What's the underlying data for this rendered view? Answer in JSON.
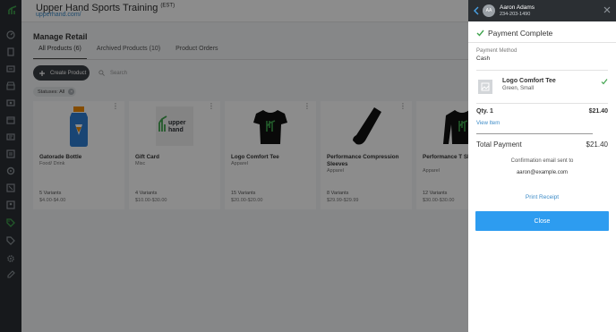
{
  "app": {
    "title": "Upper Hand Sports Training",
    "timezone": "(EST)",
    "url": "upperhand.com/"
  },
  "nav": {
    "icons": [
      "dashboard-icon",
      "book-icon",
      "reports-icon",
      "store-icon",
      "money-icon",
      "calendar-icon",
      "clients-icon",
      "messages-icon",
      "list-icon",
      "loop-icon",
      "schedule-icon",
      "contacts-icon",
      "retail-icon",
      "tag-icon",
      "settings-icon",
      "edit-icon"
    ]
  },
  "main": {
    "page_title": "Manage Retail",
    "tabs": [
      {
        "label": "All Products (6)"
      },
      {
        "label": "Archived Products (10)"
      },
      {
        "label": "Product Orders"
      }
    ],
    "create_label": "Create Product",
    "search_placeholder": "Search",
    "status_filter": "Statuses: All",
    "products": [
      {
        "name": "Gatorade Bottle",
        "category": "Food/ Drink",
        "variants": "5 Variants",
        "price": "$4.00-$4.00"
      },
      {
        "name": "Gift Card",
        "category": "Misc",
        "variants": "4 Variants",
        "price": "$10.00-$30.00",
        "logo_text": "upper hand"
      },
      {
        "name": "Logo Comfort Tee",
        "category": "Apparel",
        "variants": "15 Variants",
        "price": "$20.00-$20.00"
      },
      {
        "name": "Performance Compression Sleeves",
        "category": "Apparel",
        "variants": "8 Variants",
        "price": "$29.99-$29.99"
      },
      {
        "name": "Performance T Sl Sleeve",
        "category": "Apparel",
        "variants": "12 Variants",
        "price": "$30.00-$30.00"
      }
    ]
  },
  "drawer": {
    "client": {
      "initials": "AA",
      "name": "Aaron Adams",
      "phone": "234-203-1490"
    },
    "status_title": "Payment Complete",
    "payment_method_label": "Payment Method",
    "payment_method": "Cash",
    "item": {
      "name": "Logo Comfort Tee",
      "description": "Green, Small"
    },
    "qty_label": "Qty. 1",
    "line_total": "$21.40",
    "view_item": "View Item",
    "total_label": "Total Payment",
    "total_value": "$21.40",
    "confirmation_text": "Confirmation email sent to",
    "email": "aaron@example.com",
    "print_receipt": "Print Receipt",
    "close_label": "Close"
  },
  "colors": {
    "brand_green": "#3fa34d",
    "nav_dark": "#2b2f33",
    "link_blue": "#3d8bc7",
    "primary_button": "#2d9cf0"
  }
}
